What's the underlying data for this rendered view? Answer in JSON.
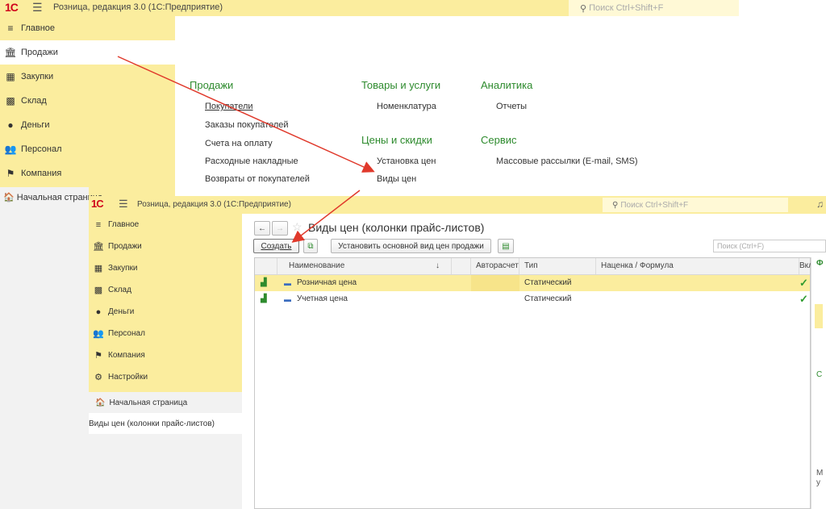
{
  "app": {
    "logo": "1С",
    "title": "Розница, редакция 3.0  (1С:Предприятие)",
    "title_small": "Розница, редакция 3.0  (1С:Предприятие)",
    "search_placeholder": "Поиск Ctrl+Shift+F"
  },
  "sections": [
    {
      "name": "Главное",
      "icon": "list-icon"
    },
    {
      "name": "Продажи",
      "icon": "bank-icon"
    },
    {
      "name": "Закупки",
      "icon": "cart-icon"
    },
    {
      "name": "Склад",
      "icon": "warehouse-icon"
    },
    {
      "name": "Деньги",
      "icon": "money-icon"
    },
    {
      "name": "Персонал",
      "icon": "people-icon"
    },
    {
      "name": "Компания",
      "icon": "flag-icon"
    },
    {
      "name": "Настройки",
      "icon": "gear-icon"
    }
  ],
  "home_link": "Начальная страница",
  "sales_panel": {
    "col1_title": "Продажи",
    "col1_items": [
      "Покупатели",
      "Заказы покупателей",
      "Счета на оплату",
      "Расходные накладные",
      "Возвраты от покупателей"
    ],
    "col2_title": "Товары и услуги",
    "col2_items": [
      "Номенклатура"
    ],
    "col2b_title": "Цены и скидки",
    "col2b_items": [
      "Установка цен",
      "Виды цен"
    ],
    "col3_title": "Аналитика",
    "col3_items": [
      "Отчеты"
    ],
    "col3b_title": "Сервис",
    "col3b_items": [
      "Массовые рассылки (E-mail, SMS)"
    ]
  },
  "open_window": "Виды цен (колонки прайс-листов)",
  "form": {
    "title": "Виды цен (колонки прайс-листов)",
    "create_button": "Создать",
    "set_main_button": "Установить основной вид цен продажи",
    "search_placeholder": "Поиск (Ctrl+F)",
    "columns": [
      "Наименование",
      "Авторасчет",
      "Тип",
      "Наценка / Формула",
      "Вкл"
    ],
    "sort_mark": "↓",
    "rows": [
      {
        "name": "Розничная цена",
        "auto": "",
        "type": "Статический",
        "markup": "",
        "enabled": "✓"
      },
      {
        "name": "Учетная цена",
        "auto": "",
        "type": "Статический",
        "markup": "",
        "enabled": "✓"
      }
    ]
  },
  "right_panel_letters": [
    "Ф",
    "С",
    "М",
    "у"
  ],
  "colors": {
    "accent_yellow": "#fbed9e",
    "green": "#2e8b2e",
    "arrow_red": "#e0392b"
  }
}
